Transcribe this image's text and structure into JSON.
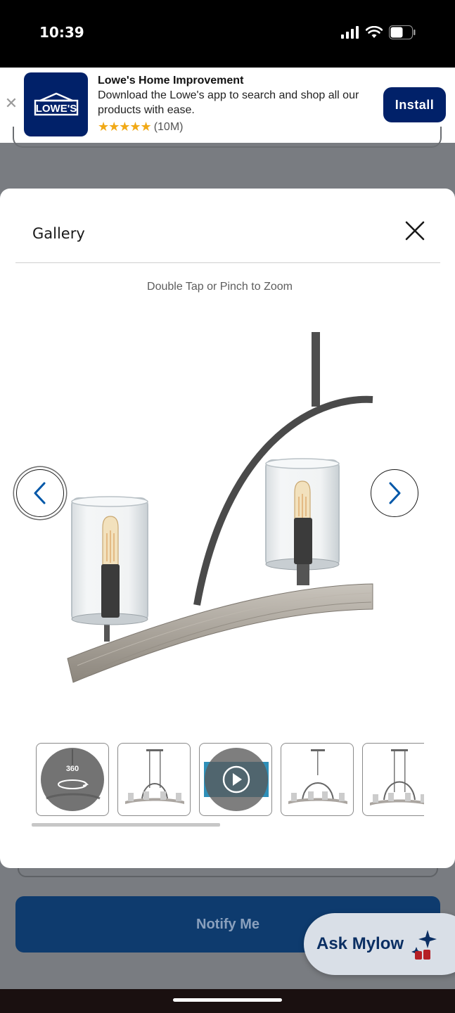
{
  "status_bar": {
    "time": "10:39"
  },
  "app_banner": {
    "close_icon": "close-icon",
    "logo_text": "LOWE'S",
    "title": "Lowe's Home Improvement",
    "description": "Download the Lowe's app to search and shop all our products with ease.",
    "stars": "★★★★★",
    "rating_count": "(10M)",
    "install_label": "Install",
    "brand_color": "#012169"
  },
  "gallery": {
    "title": "Gallery",
    "zoom_hint": "Double Tap or Pinch to Zoom",
    "prev_icon": "chevron-left-icon",
    "next_icon": "chevron-right-icon",
    "thumbnails": [
      {
        "type": "360",
        "label": "360"
      },
      {
        "type": "image"
      },
      {
        "type": "video"
      },
      {
        "type": "image"
      },
      {
        "type": "image"
      }
    ]
  },
  "page": {
    "notify_label": "Notify Me",
    "ask_mylow_label": "Ask Mylow"
  }
}
